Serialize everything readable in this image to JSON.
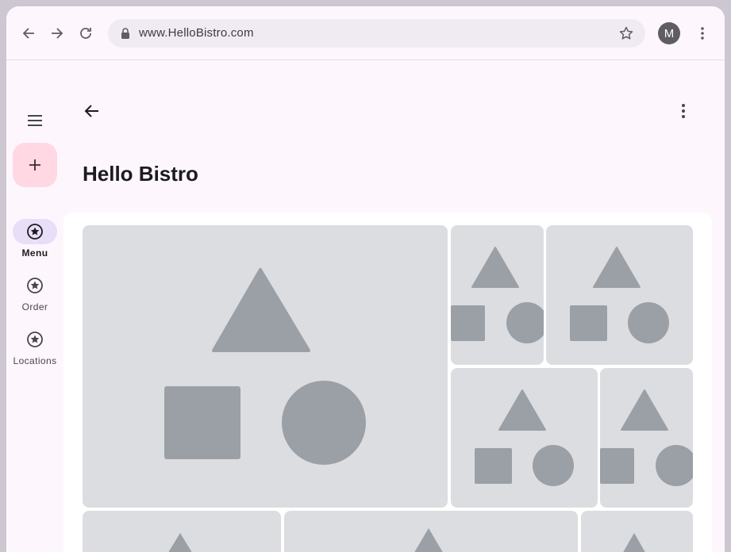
{
  "browser": {
    "url": "www.HelloBistro.com",
    "avatar_initial": "M",
    "icons": [
      "back-arrow-icon",
      "forward-arrow-icon",
      "reload-icon",
      "lock-icon",
      "bookmark-star-icon",
      "more-vert-icon"
    ]
  },
  "rail": {
    "items": [
      {
        "label": "Menu",
        "icon": "star-circle-icon",
        "active": true
      },
      {
        "label": "Order",
        "icon": "star-circle-icon",
        "active": false
      },
      {
        "label": "Locations",
        "icon": "star-circle-icon",
        "active": false
      }
    ]
  },
  "page": {
    "title": "Hello Bistro"
  },
  "gallery": {
    "tile_count": 9,
    "placeholder_color": "#9aa0a6",
    "tile_color": "#dcdde0"
  },
  "colors": {
    "background": "#fdf7fd",
    "fab": "#ffd8e4",
    "active_pill": "#e8def8"
  }
}
